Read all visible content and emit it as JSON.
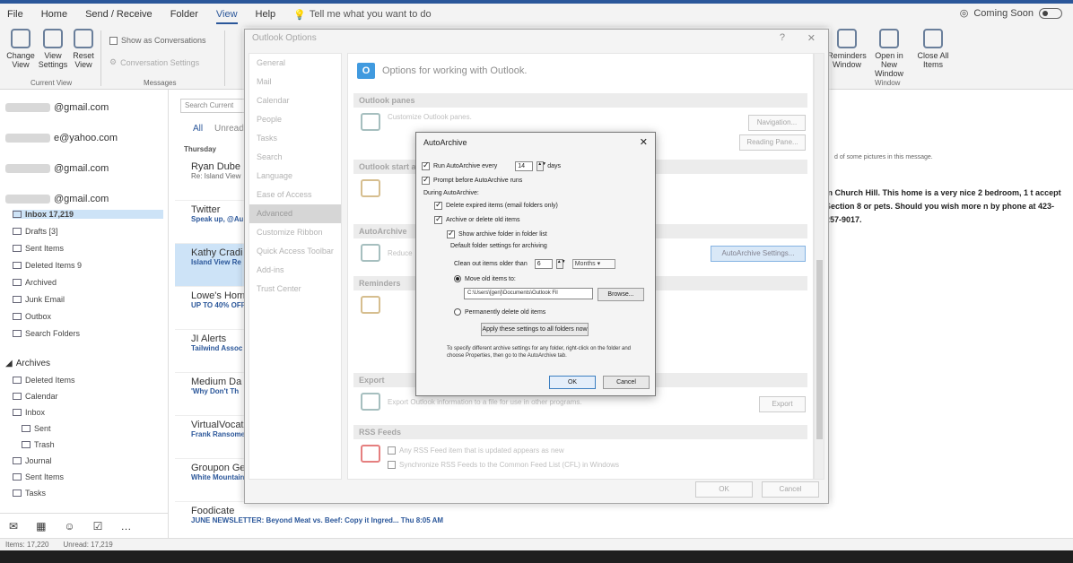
{
  "menu": {
    "tabs": [
      "File",
      "Home",
      "Send / Receive",
      "Folder",
      "View",
      "Help"
    ],
    "active_tab": "View",
    "tell_me": "Tell me what you want to do",
    "coming_soon": "Coming Soon"
  },
  "ribbon": {
    "change_view": "Change View",
    "view_settings": "View Settings",
    "reset_view": "Reset View",
    "current_view_group": "Current View",
    "show_as_conversations": "Show as Conversations",
    "conversation_settings": "Conversation Settings",
    "messages_group": "Messages",
    "reminders_window": "Reminders Window",
    "open_in_new_window": "Open in New Window",
    "close_all_items": "Close All Items",
    "window_group": "Window"
  },
  "folders": {
    "accounts": [
      "@gmail.com",
      "e@yahoo.com",
      "@gmail.com",
      "@gmail.com"
    ],
    "items": [
      "Inbox 17,219",
      "Drafts [3]",
      "Sent Items",
      "Deleted Items 9",
      "Archived",
      "Junk Email",
      "Outbox",
      "Search Folders"
    ],
    "archives_label": "Archives",
    "archive_items": [
      "Deleted Items",
      "Calendar",
      "Inbox",
      "Sent",
      "Trash",
      "Journal",
      "Sent Items",
      "Tasks"
    ]
  },
  "mail": {
    "search_placeholder": "Search Current",
    "filter_all": "All",
    "filter_unread": "Unread",
    "day_header": "Thursday",
    "items": [
      {
        "name": "Ryan Dube",
        "subj": "Re: Island View"
      },
      {
        "name": "Twitter",
        "subj": "Speak up, @Au"
      },
      {
        "name": "Kathy Cradi",
        "subj": "Island View Re"
      },
      {
        "name": "Lowe's Hom",
        "subj": "UP TO 40% OFF"
      },
      {
        "name": "JI Alerts",
        "subj": "Tailwind Assoc"
      },
      {
        "name": "Medium Da",
        "subj": "'Why Don't Th"
      },
      {
        "name": "VirtualVocat",
        "subj": "Frank Ransome"
      },
      {
        "name": "Groupon Ge",
        "subj": "White Mountain"
      },
      {
        "name": "Foodicate",
        "subj": "JUNE NEWSLETTER: Beyond Meat vs. Beef: Copy it Ingred...   Thu 8:05 AM"
      }
    ]
  },
  "reading": {
    "body": "in Church Hill. This home is a very nice 2 bedroom, 1 t accept Section 8 or pets. Should you wish more n by phone at 423-257-9017.",
    "info": "d of some pictures in this message."
  },
  "status": {
    "items": "Items: 17,220",
    "unread": "Unread: 17,219"
  },
  "options": {
    "title": "Outlook Options",
    "nav": [
      "General",
      "Mail",
      "Calendar",
      "People",
      "Tasks",
      "Search",
      "Language",
      "Ease of Access",
      "Advanced",
      "Customize Ribbon",
      "Quick Access Toolbar",
      "Add-ins",
      "Trust Center"
    ],
    "selected_nav": "Advanced",
    "header": "Options for working with Outlook.",
    "sections": {
      "panes": "Outlook panes",
      "panes_text": "Customize Outlook panes.",
      "navigation_btn": "Navigation...",
      "reading_pane_btn": "Reading Pane...",
      "start": "Outlook start and exit",
      "autoarchive": "AutoArchive",
      "autoarchive_text": "Reduce",
      "autoarchive_btn": "AutoArchive Settings...",
      "reminders": "Reminders",
      "export": "Export",
      "export_text": "Export Outlook information to a file for use in other programs.",
      "export_btn": "Export",
      "rss": "RSS Feeds",
      "rss1": "Any RSS Feed item that is updated appears as new",
      "rss2": "Synchronize RSS Feeds to the Common Feed List (CFL) in Windows"
    },
    "ok": "OK",
    "cancel": "Cancel"
  },
  "autoarchive": {
    "title": "AutoArchive",
    "run_every": "Run AutoArchive every",
    "days_value": "14",
    "days": "days",
    "prompt": "Prompt before AutoArchive runs",
    "during": "During AutoArchive:",
    "delete_expired": "Delete expired items (email folders only)",
    "archive_delete": "Archive or delete old items",
    "show_archive": "Show archive folder in folder list",
    "defaults": "Default folder settings for archiving",
    "clean_older": "Clean out items older than",
    "months_value": "6",
    "months": "Months",
    "move_old": "Move old items to:",
    "path": "C:\\Users\\[gen]\\Documents\\Outlook Fil",
    "browse": "Browse...",
    "permanently": "Permanently delete old items",
    "apply_all": "Apply these settings to all folders now",
    "note": "To specify different archive settings for any folder, right-click on the folder and choose Properties, then go to the AutoArchive tab.",
    "ok": "OK",
    "cancel": "Cancel"
  }
}
